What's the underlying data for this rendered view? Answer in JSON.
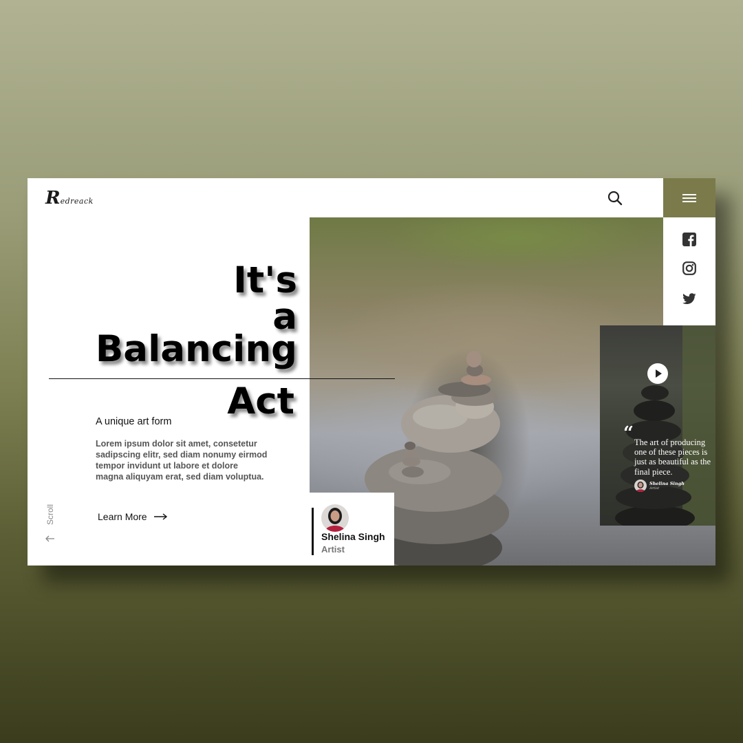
{
  "brand": {
    "logo_initial": "R",
    "logo_rest": "edreack"
  },
  "hero": {
    "title_lines": [
      "It's",
      "a",
      "Balancing",
      "Act"
    ],
    "subtitle": "A unique art form",
    "body": "Lorem ipsum dolor sit amet, consetetur sadipscing elitr, sed diam nonumy eirmod tempor invidunt ut labore et dolore magna aliquyam erat, sed diam voluptua.",
    "cta_label": "Learn More",
    "scroll_label": "Scroll"
  },
  "artist": {
    "name": "Shelina Singh",
    "role": "Artist"
  },
  "video_card": {
    "quote": "The art of producing one of these pieces is just as beautiful as the final piece.",
    "author": "Shelina Singh",
    "author_role": "Artist"
  },
  "header": {
    "icons": [
      "search-icon",
      "menu-icon"
    ]
  },
  "social": {
    "icons": [
      "facebook-icon",
      "instagram-icon",
      "twitter-icon"
    ]
  },
  "colors": {
    "accent": "#7b7a4b",
    "page_bg_top": "#b0b292",
    "page_bg_bottom": "#3a3c1c",
    "text_dark": "#111111",
    "text_muted": "#555555"
  }
}
